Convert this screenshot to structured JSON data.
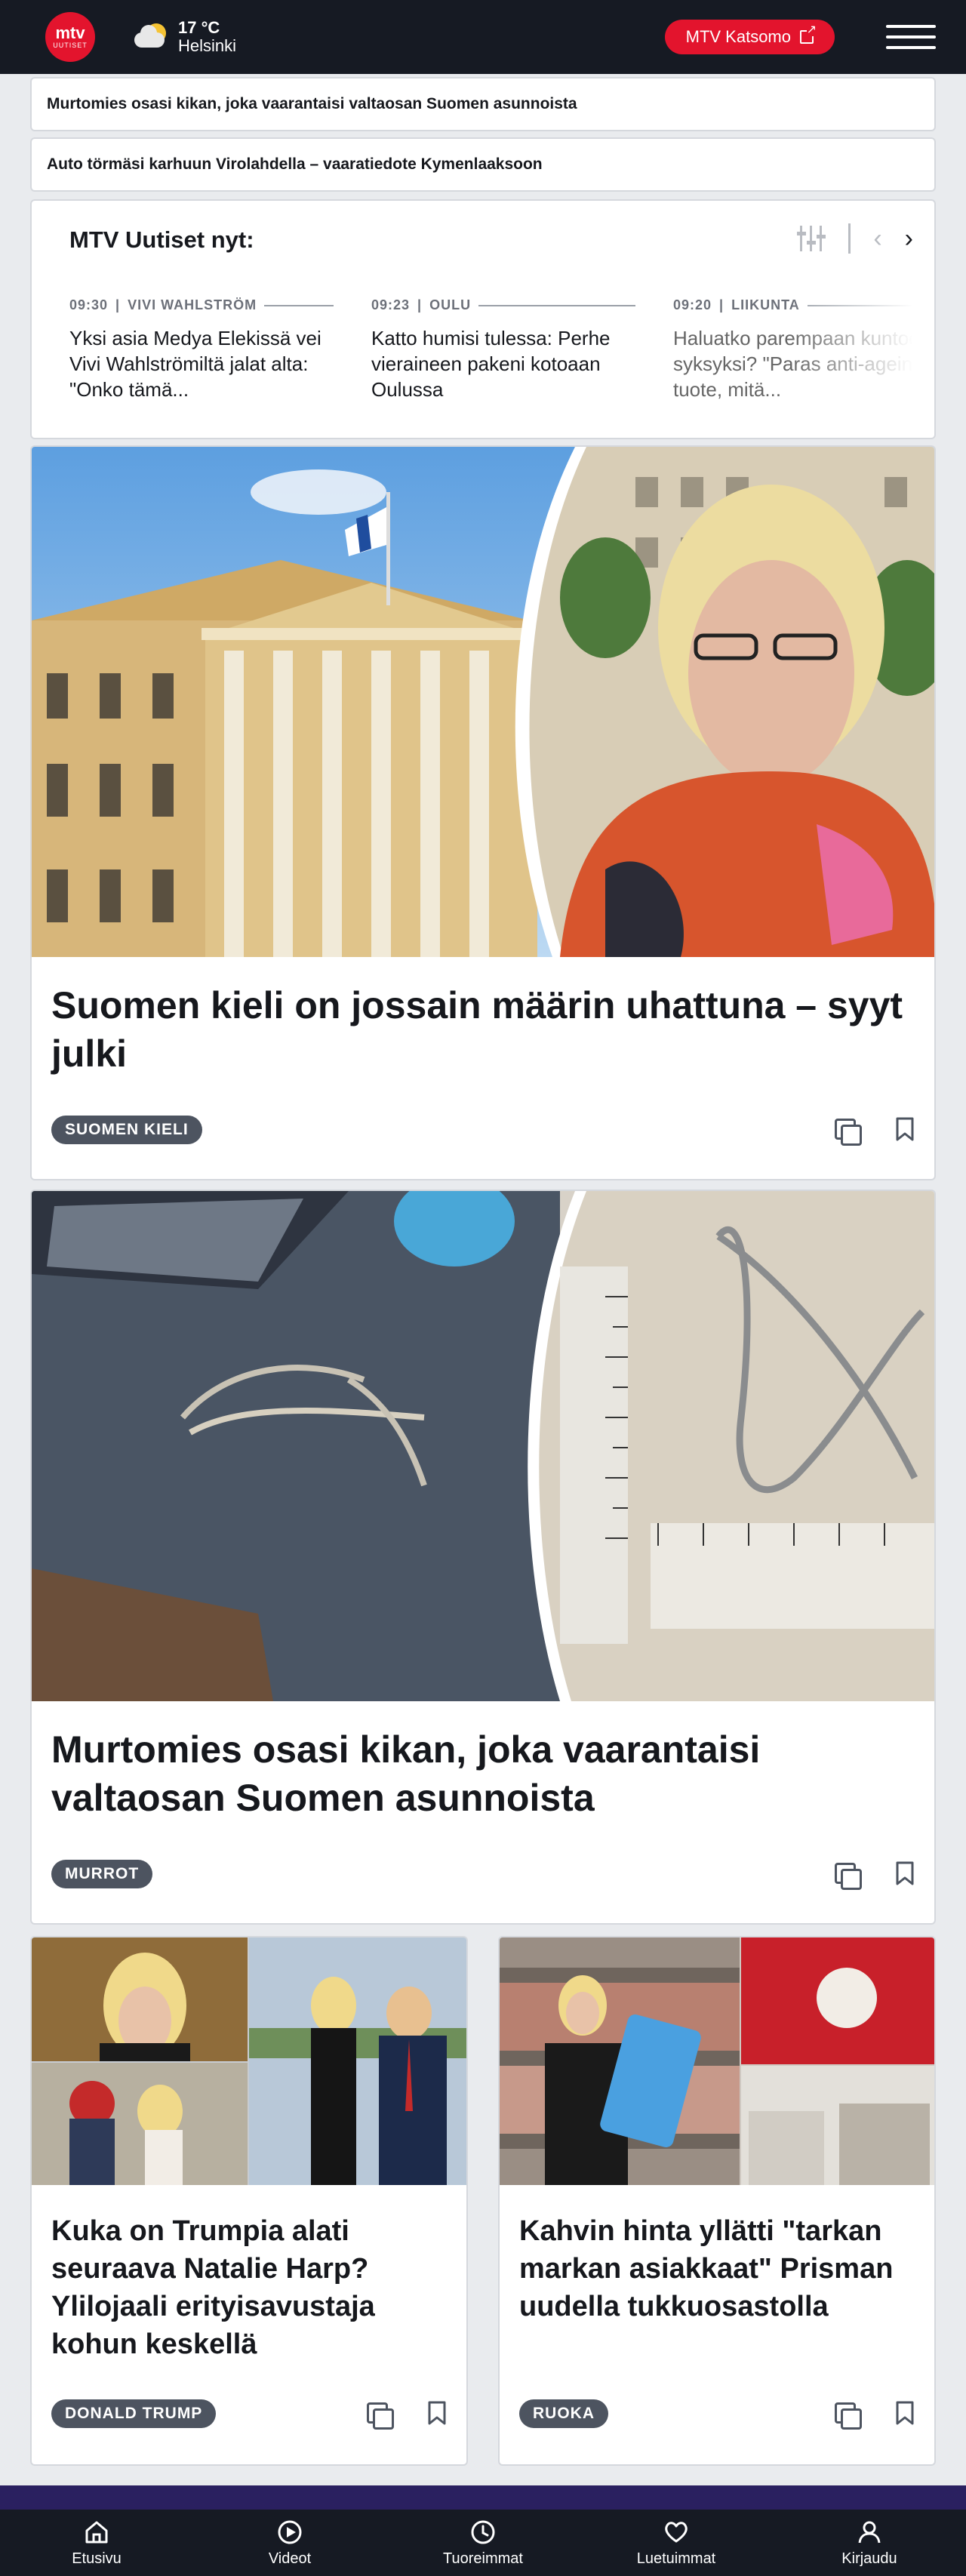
{
  "header": {
    "logo_top": "mtv",
    "logo_bottom": "UUTISET",
    "weather_temp": "17 °C",
    "weather_city": "Helsinki",
    "weather_icon": "partly-cloudy-icon",
    "katsomo_label": "MTV Katsomo",
    "accent_color": "#e3142d",
    "background_color": "#161a23"
  },
  "headline_bars": [
    "Murtomies osasi kikan, joka vaarantaisi valtaosan Suomen asunnoista",
    "Auto törmäsi karhuun Virolahdella – vaaratiedote Kymenlaaksoon"
  ],
  "news_now": {
    "title": "MTV Uutiset nyt:",
    "items": [
      {
        "time": "09:30",
        "category": "VIVI WAHLSTRÖM",
        "text": "Yksi asia Medya Elekissä vei Vivi Wahlströmiltä jalat alta: \"Onko tämä..."
      },
      {
        "time": "09:23",
        "category": "OULU",
        "text": "Katto humisi tulessa: Perhe vieraineen pakeni kotoaan Oulussa"
      },
      {
        "time": "09:20",
        "category": "LIIKUNTA",
        "text": "Haluatko parempaan kuntoon syksyksi? \"Paras anti-ageing-tuote, mitä..."
      }
    ]
  },
  "articles": [
    {
      "title": "Suomen kieli on jossain määrin uhattuna – syyt julki",
      "tag": "SUOMEN KIELI"
    },
    {
      "title": "Murtomies osasi kikan, joka vaarantaisi valtaosan Suomen asunnoista",
      "tag": "MURROT"
    }
  ],
  "small_articles": [
    {
      "title": "Kuka on Trumpia alati seuraava Natalie Harp? Ylilojaali erityisavustaja kohun keskellä",
      "tag": "DONALD TRUMP"
    },
    {
      "title": "Kahvin hinta yllätti \"tarkan markan asiakkaat\" Prisman uudella tukkuosastolla",
      "tag": "RUOKA"
    }
  ],
  "bottom_nav": [
    {
      "label": "Etusivu",
      "icon": "home-icon"
    },
    {
      "label": "Videot",
      "icon": "play-icon"
    },
    {
      "label": "Tuoreimmat",
      "icon": "clock-icon"
    },
    {
      "label": "Luetuimmat",
      "icon": "heart-icon"
    },
    {
      "label": "Kirjaudu",
      "icon": "user-icon"
    }
  ]
}
